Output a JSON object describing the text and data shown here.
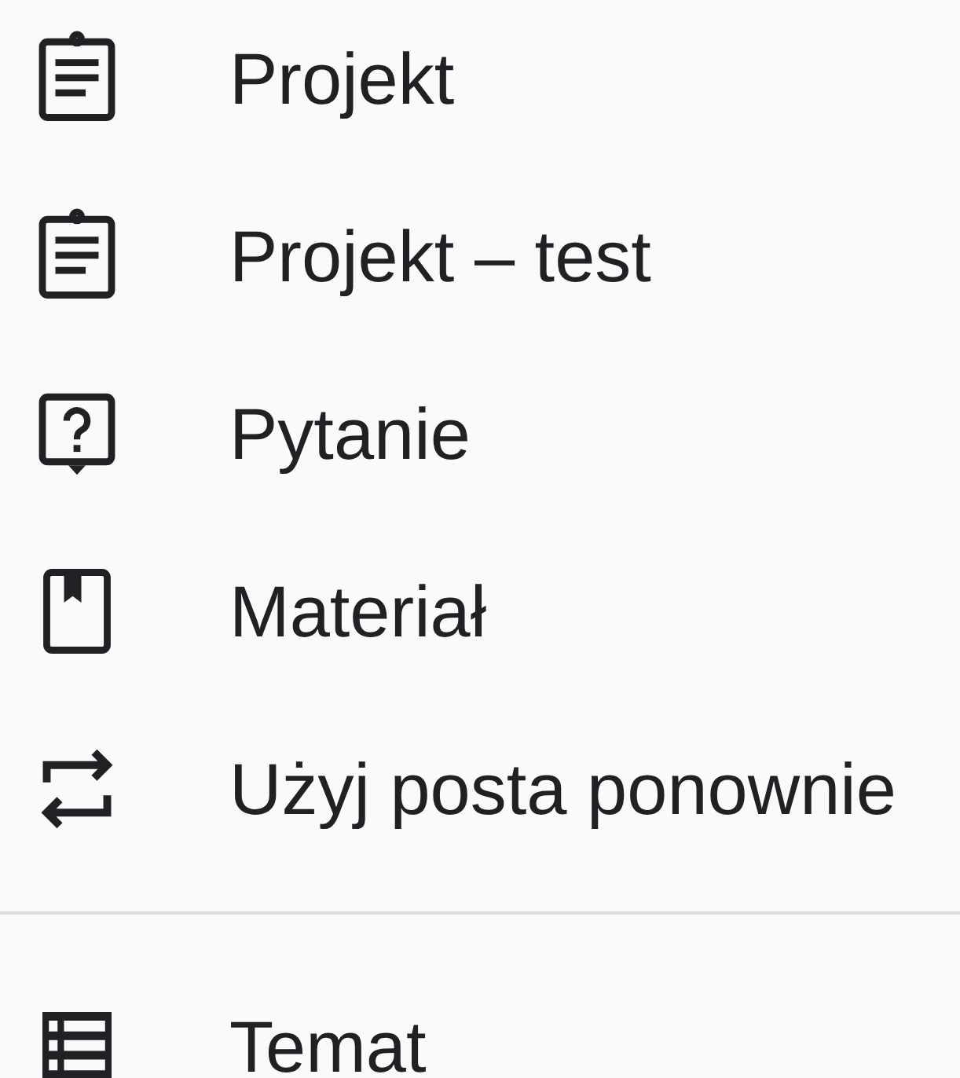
{
  "menu": {
    "sections": [
      {
        "items": [
          {
            "kind": "assignment",
            "label": "Projekt"
          },
          {
            "kind": "assignment",
            "label": "Projekt – test"
          },
          {
            "kind": "question",
            "label": "Pytanie"
          },
          {
            "kind": "material",
            "label": "Materiał"
          },
          {
            "kind": "reuse",
            "label": "Użyj posta ponownie"
          }
        ]
      },
      {
        "items": [
          {
            "kind": "topic",
            "label": "Temat"
          }
        ]
      }
    ]
  }
}
